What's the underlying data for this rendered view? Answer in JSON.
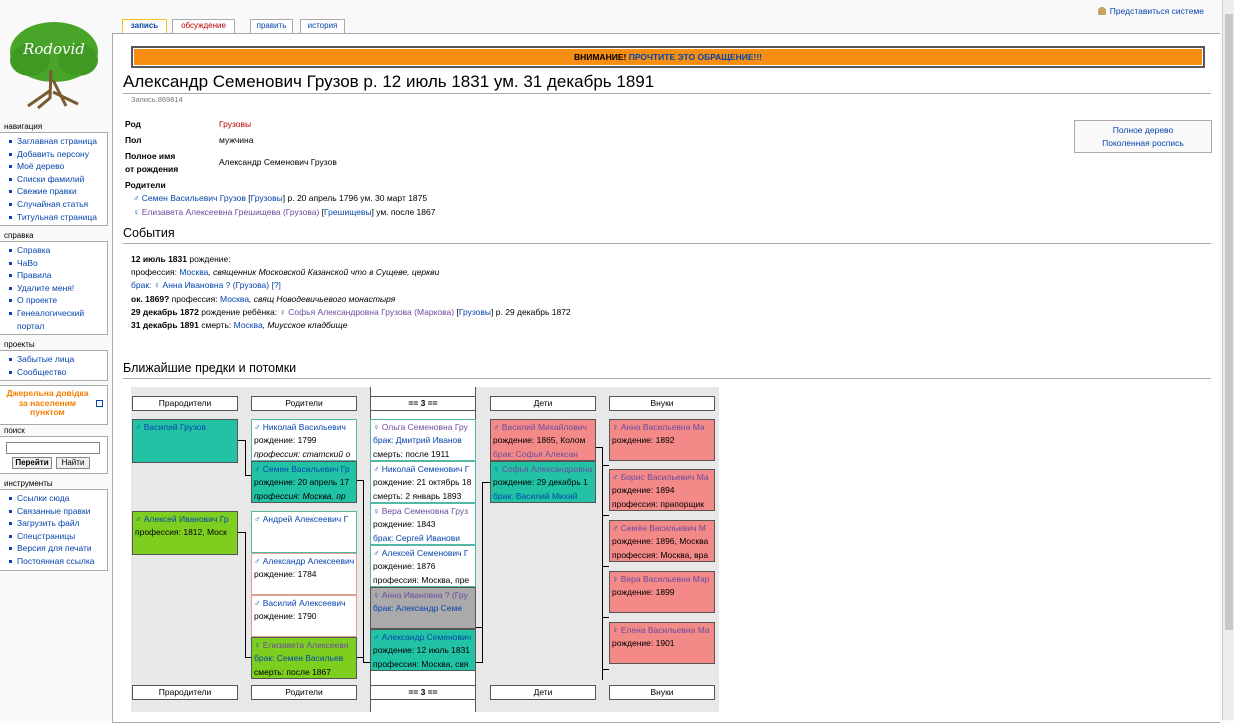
{
  "logo_text": "Rodovid",
  "personal": "Представиться системе",
  "tabs": [
    "запись",
    "обсуждение",
    "править",
    "история"
  ],
  "sidebar": {
    "navigation": {
      "title": "навигация",
      "items": [
        "Заглавная страница",
        "Добавить персону",
        "Моё дерево",
        "Списки фамилий",
        "Свежие правки",
        "Случайная статья",
        "Титульная страница"
      ]
    },
    "help": {
      "title": "справка",
      "items": [
        "Справка",
        "ЧаВо",
        "Правила",
        "Удалите меня!",
        "О проекте",
        "Генеалогический",
        "портал"
      ]
    },
    "projects": {
      "title": "проекты",
      "items": [
        "Забытые лица",
        "Сообщество"
      ]
    },
    "belarus": "Джерельна довідка за населеним пунктом",
    "search": {
      "title": "поиск",
      "go": "Перейти",
      "find": "Найти"
    },
    "tools": {
      "title": "инструменты",
      "items": [
        "Ссылки сюда",
        "Связанные правки",
        "Загрузить файл",
        "Спецстраницы",
        "Версия для печати",
        "Постоянная ссылка"
      ]
    }
  },
  "notice": {
    "warn": "ВНИМАНИЕ!",
    "link": "ПРОЧТИТЕ ЭТО ОБРАЩЕНИЕ!!!"
  },
  "title": "Александр Семенович Грузов р. 12 июль 1831 ум. 31 декабрь 1891",
  "record": "Запись:869814",
  "facts": {
    "rod_label": "Род",
    "rod_value": "Грузовы",
    "sex_label": "Пол",
    "sex_value": "мужчина",
    "fullname_label_1": "Полное имя",
    "fullname_label_2": "от рождения",
    "fullname_value": "Александр Семенович Грузов",
    "parents_label": "Родители",
    "father": {
      "name": "Семен Васильевич Грузов",
      "clan": "Грузовы",
      "dates": "р. 20 апрель 1796 ум. 30 март 1875"
    },
    "mother": {
      "name": "Елизавета Алексеевна Грешищева (Грузова)",
      "clan": "Грешищевы",
      "dates": "ум. после 1867"
    }
  },
  "tree_links": [
    "Полное дерево",
    "Поколенная роспись"
  ],
  "events_title": "События",
  "events": {
    "e1_date": "12 июль 1831",
    "e1_text": "рождение:",
    "e1_prof_label": "профессия:",
    "e1_prof_place": "Москва",
    "e1_prof_text": ", священник Московской Казанской что в Сущеве, церкви",
    "e2_label": "брак:",
    "e2_name": "Анна Ивановна ? (Грузова)",
    "e2_q": "[?]",
    "e3_date": "ок. 1869?",
    "e3_text": "профессия:",
    "e3_place": "Москва",
    "e3_desc": ", свящ Новодевичьевого монастыря",
    "e4_date": "29 декабрь 1872",
    "e4_text": "рождение ребёнка:",
    "e4_name": "Софья Александровна Грузова (Маркова)",
    "e4_clan": "Грузовы",
    "e4_after": "р. 29 декабрь 1872",
    "e5_date": "31 декабрь 1891",
    "e5_text": "смерть:",
    "e5_place": "Москва",
    "e5_desc": ", Миусское кладбище"
  },
  "tree_title": "Ближайшие предки и потомки",
  "tree_headers": [
    "Прародители",
    "Родители",
    "== 3 ==",
    "Дети",
    "Внуки"
  ],
  "cards": {
    "gp1": [
      "Василий Грузов"
    ],
    "gp2": [
      "Алексей Иванович Гр",
      "профессия: 1812, Моск"
    ],
    "p1": [
      "Николай Васильевич",
      "рождение: 1799",
      "профессия: статский о"
    ],
    "p2": [
      "Семен Васильевич Гр",
      "рождение: 20 апрель 17",
      "профессия: Москва, пр"
    ],
    "p3": [
      "Андрей Алексеевич Г"
    ],
    "p4": [
      "Александр Алексеевич",
      "рождение: 1784"
    ],
    "p5": [
      "Василий Алексеевич",
      "рождение: 1790"
    ],
    "p6": [
      "Елизавета Алексеевн",
      "брак: Семен Васильев",
      "смерть: после 1867"
    ],
    "s1": [
      "Ольга Семеновна Гру",
      "брак: Дмитрий Иванов",
      "смерть: после 1911"
    ],
    "s2": [
      "Николай Семенович Г",
      "рождение: 21 октябрь 18",
      "смерть: 2 январь 1893"
    ],
    "s3": [
      "Вера Семеновна Груз",
      "рождение: 1843",
      "брак: Сергей Иванови"
    ],
    "s4": [
      "Алексей Семенович Г",
      "рождение: 1876",
      "профессия: Москва, пре"
    ],
    "s5": [
      "Анна Ивановна ? (Гру",
      "брак: Александр Семе"
    ],
    "s6": [
      "Александр Семенович",
      "рождение: 12 июль 1831",
      "профессия: Москва, свя"
    ],
    "c1": [
      "Василий Михайлович",
      "рождение: 1865, Колом",
      "брак: Софья Алексан"
    ],
    "c2": [
      "Софья Александровна",
      "рождение: 29 декабрь 1",
      "брак: Василий Михай"
    ],
    "g1": [
      "Анна Васильевна Ма",
      "рождение: 1892"
    ],
    "g2": [
      "Борис Васильевич Ма",
      "рождение: 1894",
      "профессия: прапорщик"
    ],
    "g3": [
      "Семён Васильевич М",
      "рождение: 1896, Москва",
      "профессия: Москва, вра"
    ],
    "g4": [
      "Вера Васильевна Мар",
      "рождение: 1899"
    ],
    "g5": [
      "Елена Васильевна Ма",
      "рождение: 1901"
    ]
  },
  "colors": {
    "teal": "#22c3a5",
    "green": "#7ece20",
    "pink": "#f38a88",
    "gray": "#aaaaaa",
    "notice": "#f78e14"
  }
}
